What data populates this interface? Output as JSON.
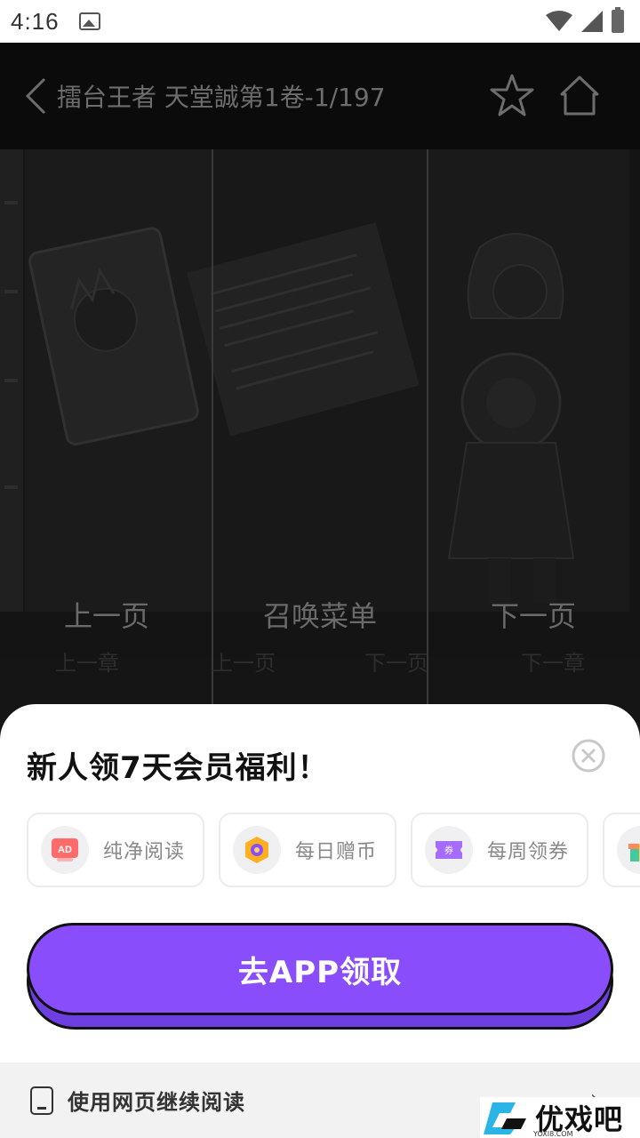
{
  "status_bar": {
    "time": "4:16"
  },
  "reader": {
    "title": "擂台王者 天堂誠第1卷-1/197",
    "zones": {
      "prev_page": "上一页",
      "menu": "召唤菜单",
      "next_page": "下一页"
    },
    "hidden_controls": [
      "上一章",
      "上一页",
      "下一页",
      "下一章"
    ]
  },
  "sheet": {
    "title": "新人领7天会员福利！",
    "benefits": [
      {
        "label": "纯净阅读",
        "icon": "ad-free-icon",
        "badge": "AD"
      },
      {
        "label": "每日赠币",
        "icon": "coin-icon"
      },
      {
        "label": "每周领券",
        "icon": "coupon-icon",
        "badge": "券"
      },
      {
        "label": "",
        "icon": "gift-icon"
      }
    ],
    "cta_label": "去APP领取",
    "footer_label": "使用网页继续阅读"
  },
  "watermark": {
    "text": "优戏吧",
    "sub": "YOXI8.COM"
  },
  "colors": {
    "accent": "#8a4dfb",
    "sheet_bg": "#ffffff",
    "reader_bg": "#151515"
  }
}
